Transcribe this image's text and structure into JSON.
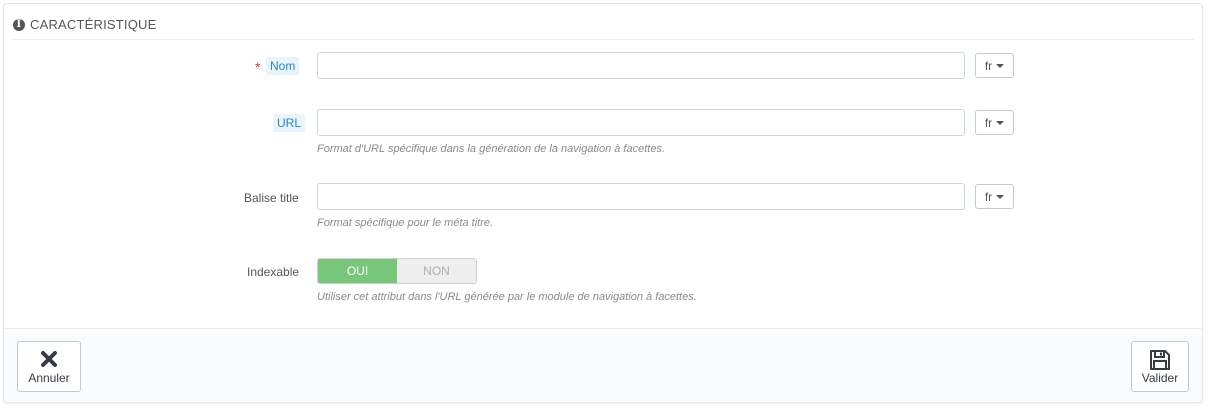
{
  "panel": {
    "title": "CARACTÉRISTIQUE",
    "icon": "info-icon"
  },
  "form": {
    "nom": {
      "label": "Nom",
      "required_mark": "*",
      "value": "",
      "lang": "fr"
    },
    "url": {
      "label": "URL",
      "value": "",
      "lang": "fr",
      "help": "Format d'URL spécifique dans la génération de la navigation à facettes."
    },
    "balise_title": {
      "label": "Balise title",
      "value": "",
      "lang": "fr",
      "help": "Format spécifique pour le méta titre."
    },
    "indexable": {
      "label": "Indexable",
      "on_label": "OUI",
      "off_label": "NON",
      "selected": "OUI",
      "help": "Utiliser cet attribut dans l'URL générée par le module de navigation à facettes."
    }
  },
  "footer": {
    "cancel_label": "Annuler",
    "cancel_icon": "close-icon",
    "save_label": "Valider",
    "save_icon": "floppy-disk-icon"
  },
  "colors": {
    "accent_label_bg": "#eaf4fb",
    "accent_label_text": "#2a84c6",
    "required": "#e0303a",
    "switch_on": "#78c679"
  }
}
